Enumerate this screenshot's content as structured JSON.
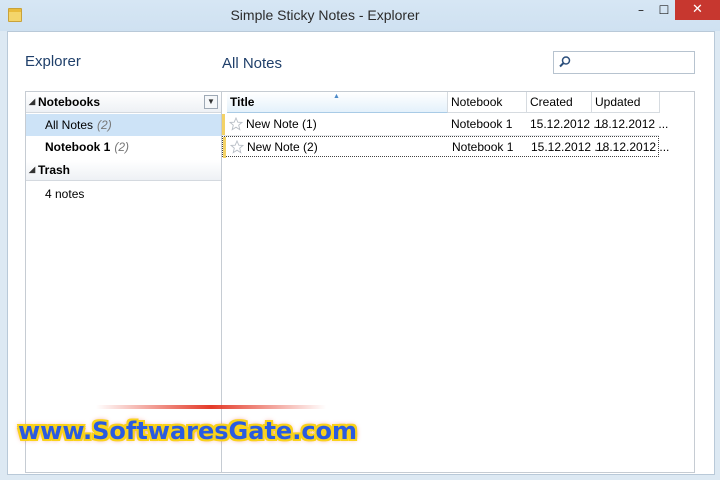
{
  "window": {
    "title": "Simple Sticky Notes - Explorer",
    "controls": {
      "minimize": "–",
      "maximize": "☐",
      "close": "✕"
    }
  },
  "headings": {
    "left": "Explorer",
    "right": "All Notes"
  },
  "search": {
    "placeholder": ""
  },
  "sidebar": {
    "notebooks_header": "Notebooks",
    "items": [
      {
        "label": "All Notes",
        "count": "(2)",
        "selected": true
      },
      {
        "label": "Notebook 1",
        "count": "(2)",
        "selected": false
      }
    ],
    "trash_header": "Trash",
    "trash_info": "4 notes"
  },
  "grid": {
    "columns": [
      "Title",
      "Notebook",
      "Created",
      "Updated"
    ],
    "rows": [
      {
        "title": "New Note (1)",
        "notebook": "Notebook 1",
        "created": "15.12.2012 ...",
        "updated": "18.12.2012 ..."
      },
      {
        "title": "New Note (2)",
        "notebook": "Notebook 1",
        "created": "15.12.2012 ...",
        "updated": "18.12.2012 ..."
      }
    ]
  },
  "watermark": "www.SoftwaresGate.com",
  "colors": {
    "heading": "#1f3f6a",
    "selection": "#cde3f7",
    "note_marker": "#f3d267",
    "close_button": "#c7372f"
  }
}
